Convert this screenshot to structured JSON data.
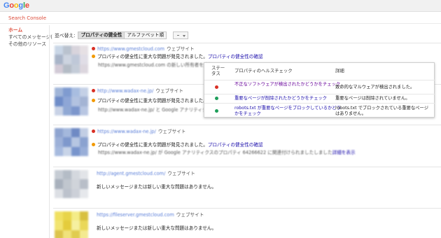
{
  "header": {
    "logo_letters": [
      {
        "ch": "G",
        "color": "#4285f4"
      },
      {
        "ch": "o",
        "color": "#ea4335"
      },
      {
        "ch": "o",
        "color": "#fbbc05"
      },
      {
        "ch": "g",
        "color": "#4285f4"
      },
      {
        "ch": "l",
        "color": "#34a853"
      },
      {
        "ch": "e",
        "color": "#ea4335"
      }
    ],
    "app_title": "Search Console"
  },
  "sidebar": {
    "items": [
      {
        "label": "ホーム",
        "active": true
      },
      {
        "label": "すべてのメッセージ(",
        "active": false
      },
      {
        "label": "その他のリソース",
        "active": false
      }
    ]
  },
  "sortbar": {
    "label": "並べ替え:",
    "options": [
      "プロパティの健全性",
      "アルファベット順"
    ],
    "selected": "プロパティの健全性"
  },
  "sites": [
    {
      "url": "https://www.gmestcloud.com",
      "type": "ウェブサイト",
      "thumb_colors": [
        "#c9d6e6",
        "#b9c2ce",
        "#d8d4dc",
        "#e6e0e4",
        "#a8b4c8",
        "#cdd4e0",
        "#bfc8d8",
        "#e0dde6",
        "#d2cad6",
        "#b4bcc6",
        "#c4ccd8",
        "#dcd6de"
      ],
      "lines": [
        {
          "dot": "red",
          "text": "プロパティの健全性に重大な問題が発見されました。",
          "link": "プロパティの健全性の確認"
        },
        {
          "dot": "orange",
          "text": "https://www.gmestcloud.com の新しい所有者を追加",
          "blur": true,
          "indent": true
        }
      ]
    },
    {
      "url": "http://www.wadax-ne.jp/",
      "type": "ウェブサイト",
      "thumb_colors": [
        "#9fb4d8",
        "#7f9bd0",
        "#a8bde0",
        "#c4d0e6",
        "#6e8cc8",
        "#8ea6d6",
        "#b2c2e0",
        "#a4b4d4",
        "#c8d2e6",
        "#90a8d4",
        "#7c96cc",
        "#b8c6e2"
      ],
      "lines": [
        {
          "dot": "red",
          "text": "プロパティの健全性に重大な問題が発見されました。"
        },
        {
          "dot": "orange",
          "text": "http://www.wadax-ne.jp/ と Google アナリティクスの",
          "blur": true,
          "indent": true
        }
      ]
    },
    {
      "url": "https://www.wadax-ne.jp/",
      "type": "ウェブサイト",
      "thumb_colors": [
        "#8ea4d0",
        "#a4b8dc",
        "#6f8ac4",
        "#c2cee4",
        "#9cb0d8",
        "#7e98cc",
        "#b6c6e2",
        "#8aa2d0",
        "#a6bade",
        "#c8d4e8",
        "#7894cc",
        "#98aed8"
      ],
      "lines": [
        {
          "dot": "red",
          "text": "プロパティの健全性に重大な問題が発見されました。",
          "link": "プロパティの健全性の確認"
        },
        {
          "dot": "orange",
          "text": "https://www.wadax-ne.jp/ が Google アナリティクスのプロパティ 64266622 に関連付けられましたしました",
          "link": "詳細を表示",
          "blur": true,
          "indent": true
        }
      ]
    },
    {
      "url": "http://agent.gmestcloud.com/",
      "type": "ウェブサイト",
      "thumb_colors": [
        "#c6ccd4",
        "#b4bcc6",
        "#d4d8de",
        "#e2e4e8",
        "#a8b0bc",
        "#c0c6ce",
        "#d0d4da",
        "#b8bec8",
        "#dcdfe4",
        "#bcc2cc",
        "#ccd0d8",
        "#e6e8ec"
      ],
      "lines": [
        {
          "dot": "",
          "text": "新しいメッセージまたは新しい重大な問題はありません。"
        }
      ]
    },
    {
      "url": "https://fileserver.gmestcloud.com",
      "type": "ウェブサイト",
      "thumb_colors": [
        "#f0e060",
        "#e8d448",
        "#f4ec88",
        "#d8c040",
        "#f2e470",
        "#e4cc3c",
        "#f6f0a0",
        "#ead858",
        "#dcc44c",
        "#f0e27c",
        "#e0cc50",
        "#f4ea90"
      ],
      "lines": [
        {
          "dot": "",
          "text": "新しいメッセージまたは新しい重大な問題はありません。"
        }
      ]
    }
  ],
  "popup": {
    "headers": {
      "status": "ステータス",
      "check": "プロパティのヘルスチェック",
      "detail": "詳細"
    },
    "rows": [
      {
        "status": "red",
        "check": "不正なソフトウェアが検出されたかどうかをチェック",
        "detail": "致命的なマルウェアが検出されました。"
      },
      {
        "status": "green",
        "check": "重要なページが削除されたかどうかをチェック",
        "detail": "重要なページは削除されていません。"
      },
      {
        "status": "green",
        "check": "robots.txt が重要なページをブロックしているかどうかをチェック",
        "detail": "robots.txt でブロックされている重要なページはありません。"
      }
    ]
  },
  "colors": {
    "accent": "#dd4b39",
    "link": "#1a0dab",
    "visited_link": "#660099"
  }
}
